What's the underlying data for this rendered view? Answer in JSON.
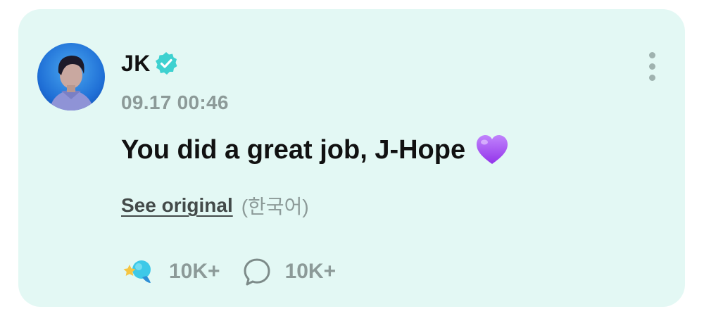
{
  "post": {
    "author": "JK",
    "verified_icon": "verified-badge-icon",
    "timestamp": "09.17 00:46",
    "message": "You did a great job, J-Hope",
    "message_emoji": "purple-heart-icon",
    "see_original_label": "See original",
    "original_language": "(한국어)",
    "reactions": {
      "icon": "star-wand-icon",
      "count": "10K+"
    },
    "comments": {
      "icon": "speech-bubble-icon",
      "count": "10K+"
    },
    "more_icon": "more-vertical-icon"
  },
  "colors": {
    "card_background": "#e3f8f4",
    "verified_badge": "#3ed1d0",
    "heart": "#a855f7",
    "secondary_text": "#8c9a98"
  }
}
